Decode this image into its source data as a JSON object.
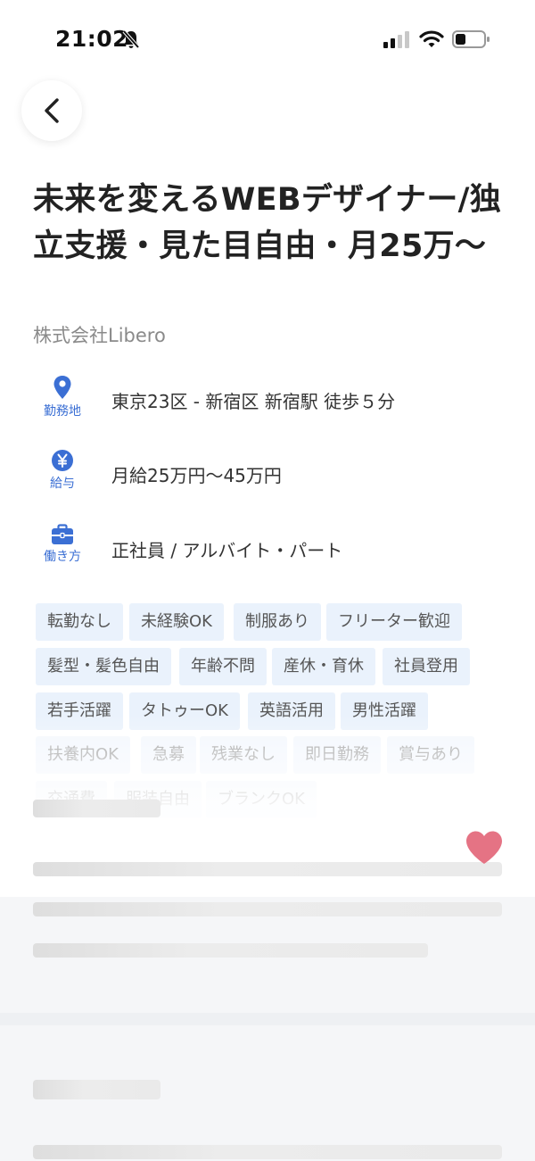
{
  "status_bar": {
    "time": "21:02"
  },
  "job": {
    "title": "未来を変えるWEBデザイナー/独立支援・見た目自由・月25万〜",
    "company": "株式会社Libero"
  },
  "info": {
    "location": {
      "label": "勤務地",
      "value": "東京23区 - 新宿区 新宿駅 徒歩５分"
    },
    "salary": {
      "label": "給与",
      "value": "月給25万円〜45万円"
    },
    "work_style": {
      "label": "働き方",
      "value": "正社員 / アルバイト・パート"
    }
  },
  "tags": [
    "転勤なし",
    "未経験OK",
    "制服あり",
    "フリーター歓迎",
    "髪型・髪色自由",
    "年齢不問",
    "産休・育休",
    "社員登用",
    "若手活躍",
    "タトゥーOK",
    "英語活用",
    "男性活躍",
    "扶養内OK",
    "急募",
    "残業なし",
    "即日勤務",
    "賞与あり",
    "交通費",
    "服装自由",
    "ブランクOK"
  ],
  "colors": {
    "accent": "#3b6fd4",
    "tag_bg": "#eaf2fc",
    "heart": "#e57384"
  }
}
